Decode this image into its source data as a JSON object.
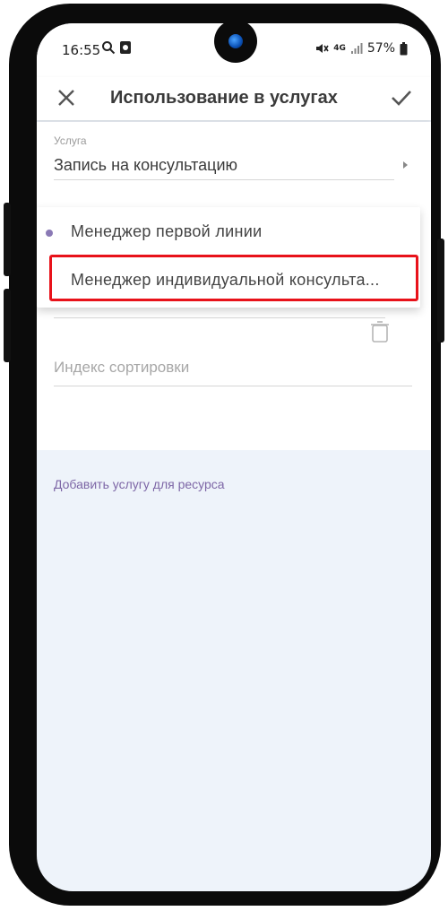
{
  "status": {
    "time": "16:55",
    "network": "4G",
    "battery": "57%"
  },
  "appbar": {
    "title": "Использование в услугах",
    "close_icon": "close-icon",
    "confirm_icon": "check-icon"
  },
  "form": {
    "service_label": "Услуга",
    "service_value": "Запись на консультацию",
    "sort_index_placeholder": "Индекс сортировки",
    "delete_icon": "trash-icon"
  },
  "dropdown": {
    "items": [
      {
        "label": "Менеджер первой линии",
        "selected": true
      },
      {
        "label": "Менеджер индивидуальной консульта..."
      }
    ],
    "highlight_color": "#e8121a"
  },
  "actions": {
    "add_service_label": "Добавить услугу для ресурса"
  },
  "colors": {
    "accent": "#7d66a6",
    "background": "#eef3fa"
  }
}
